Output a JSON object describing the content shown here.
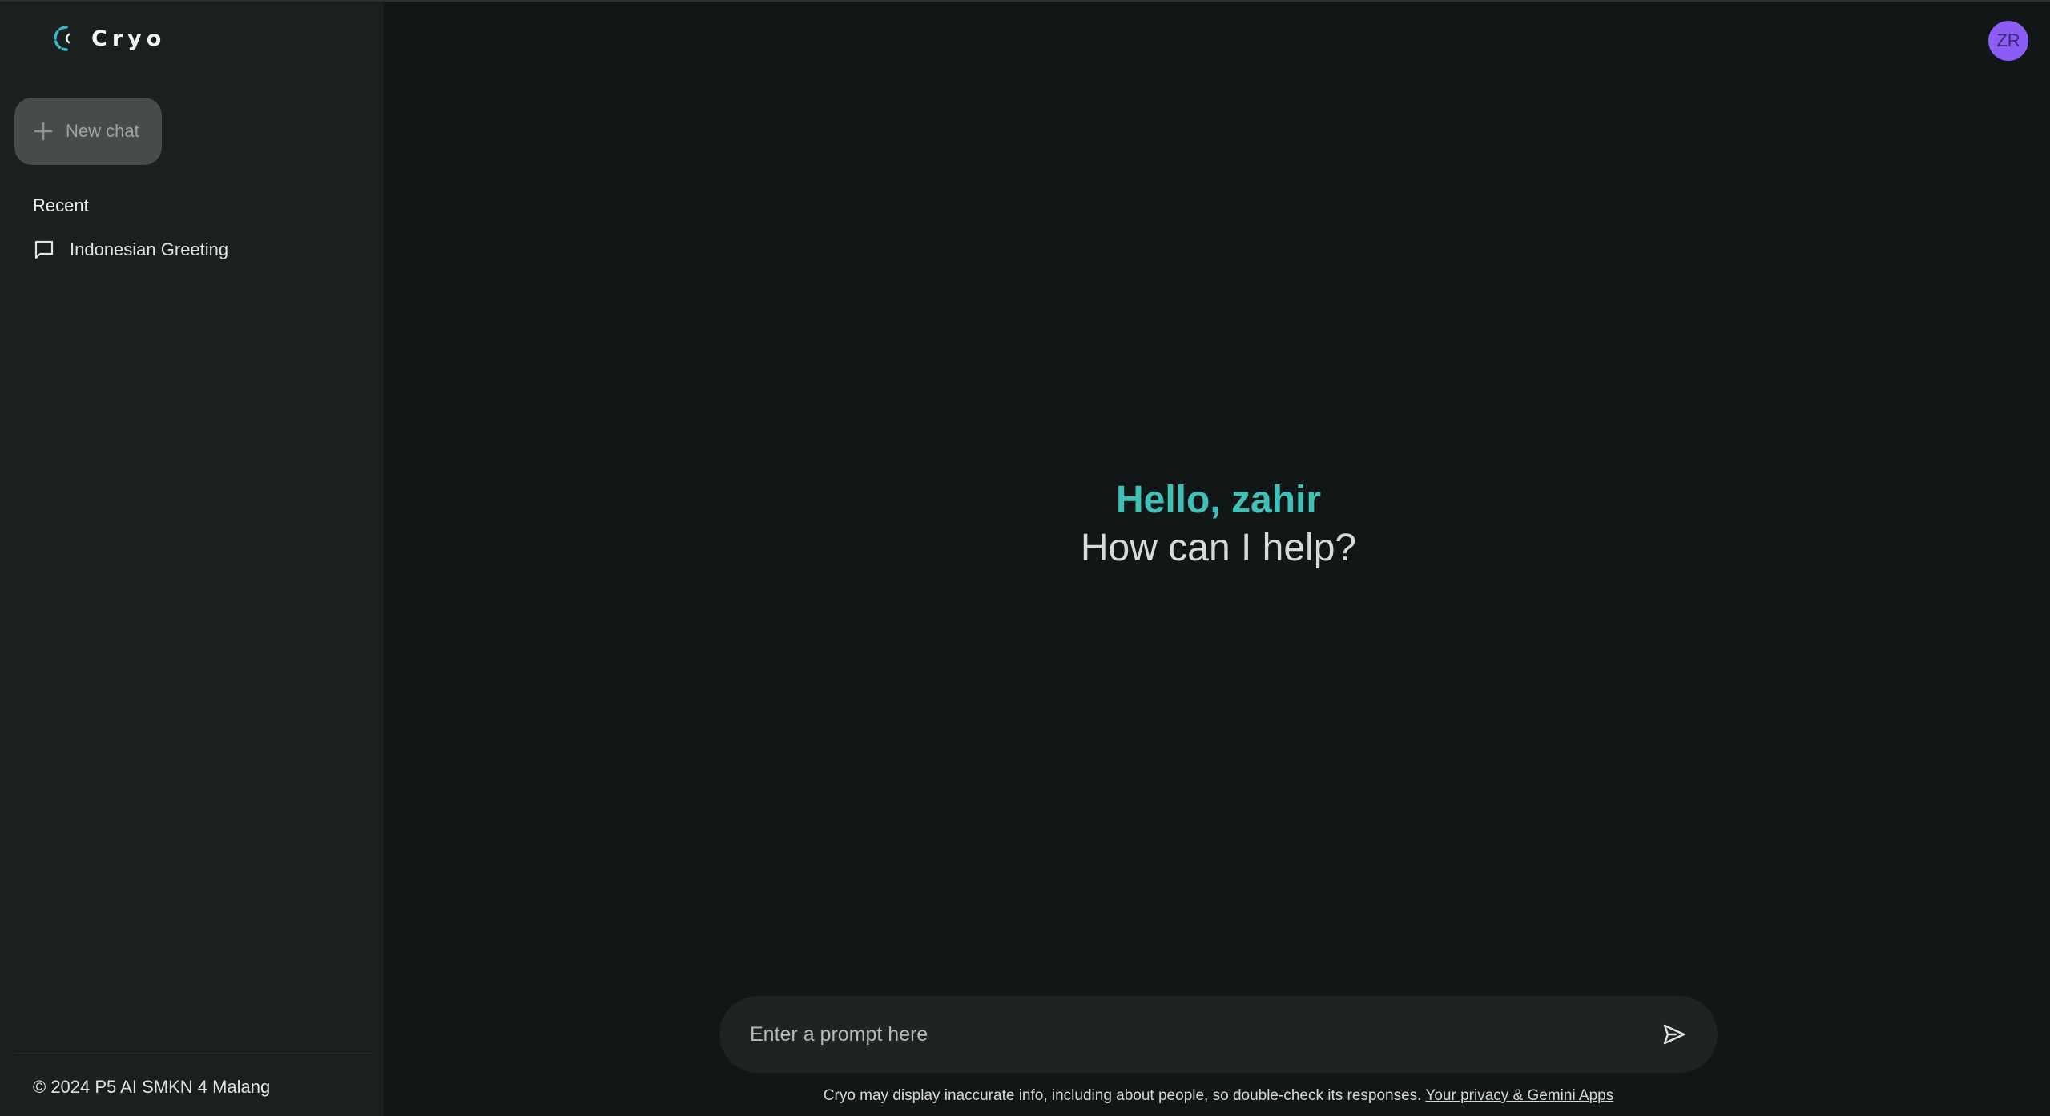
{
  "brand": {
    "name": "Cryo",
    "logo_color": "#36b8c9"
  },
  "sidebar": {
    "new_chat_label": "New chat",
    "recent_heading": "Recent",
    "recent_items": [
      {
        "label": "Indonesian Greeting",
        "icon": "chat-bubble-icon"
      }
    ],
    "footer": "© 2024 P5 AI SMKN 4 Malang"
  },
  "user": {
    "initials": "ZR",
    "avatar_color": "#8b5cf6"
  },
  "greeting": {
    "hello": "Hello, zahir",
    "question": "How can I help?",
    "accent_color": "#3fc1b8"
  },
  "prompt": {
    "placeholder": "Enter a prompt here",
    "value": "",
    "send_icon": "send-icon"
  },
  "disclaimer": {
    "text": "Cryo may display inaccurate info, including about people, so double-check its responses.",
    "link_text": "Your privacy & Gemini Apps"
  }
}
